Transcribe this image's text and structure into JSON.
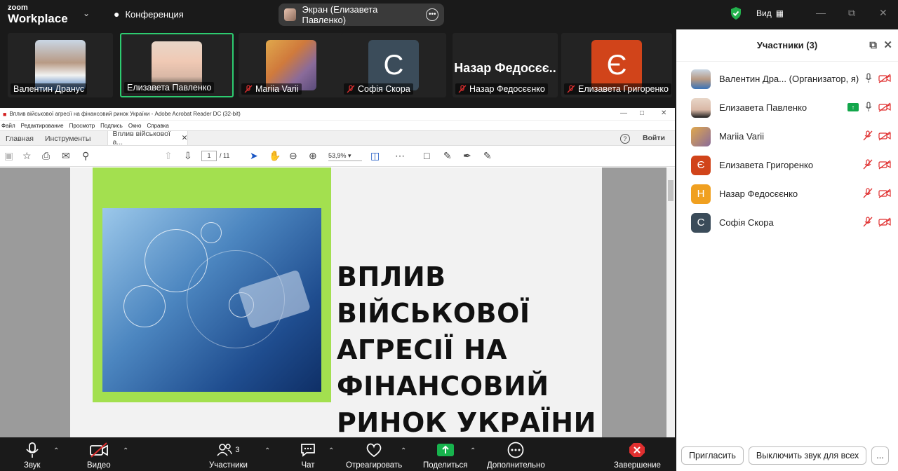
{
  "app": {
    "logo_line1": "zoom",
    "logo_line2": "Workplace",
    "conference_label": "Конференция",
    "share_pill_label": "Экран (Елизавета Павленко)",
    "view_label": "Вид"
  },
  "gallery": [
    {
      "name": "Валентин Дранус",
      "muted": false,
      "avatar": "photo"
    },
    {
      "name": "Елизавета Павленко",
      "muted": false,
      "avatar": "photo",
      "active": true
    },
    {
      "name": "Mariia Varii",
      "muted": true,
      "avatar": "cartoon"
    },
    {
      "name": "Софія Скора",
      "muted": true,
      "avatar": "letter",
      "letter": "С",
      "color": "#3b4c5a"
    },
    {
      "name": "Назар Федосєєнко",
      "muted": true,
      "avatar": "bigname",
      "bigname": "Назар  Федосєє.."
    },
    {
      "name": "Елизавета Григоренко",
      "muted": true,
      "avatar": "letter",
      "letter": "Є",
      "color": "#d1441a"
    }
  ],
  "acrobat": {
    "window_title": "Вплив військової агресії на фінансовий ринок України - Adobe Acrobat Reader DC (32-bit)",
    "menu": [
      "Файл",
      "Редактирование",
      "Просмотр",
      "Подпись",
      "Окно",
      "Справка"
    ],
    "tabs": {
      "home": "Главная",
      "tools": "Инструменты",
      "doc": "Вплив військової а..."
    },
    "login": "Войти",
    "help": "?",
    "page_current": "1",
    "page_total": "/ 11",
    "zoom": "53,9%",
    "slide_heading": [
      "ВПЛИВ",
      "ВІЙСЬКОВОЇ",
      "АГРЕСІЇ НА",
      "ФІНАНСОВИЙ",
      "РИНОК УКРАЇНИ"
    ]
  },
  "panel": {
    "title": "Участники (3)",
    "participants": [
      {
        "name": "Валентин Дра...",
        "suffix": "(Организатор, я)",
        "avatar": "photo",
        "mic": "on",
        "video": "off",
        "sharing": false
      },
      {
        "name": "Елизавета Павленко",
        "suffix": "",
        "avatar": "photo",
        "mic": "on",
        "video": "off",
        "sharing": true
      },
      {
        "name": "Mariia Varii",
        "suffix": "",
        "avatar": "cartoon",
        "mic": "off",
        "video": "off",
        "sharing": false
      },
      {
        "name": "Елизавета Григоренко",
        "suffix": "",
        "avatar": "letter",
        "letter": "Є",
        "color": "#d1441a",
        "mic": "off",
        "video": "off",
        "sharing": false
      },
      {
        "name": "Назар Федосєєнко",
        "suffix": "",
        "avatar": "letter",
        "letter": "Н",
        "color": "#f0a020",
        "mic": "off",
        "video": "off",
        "sharing": false
      },
      {
        "name": "Софія Скора",
        "suffix": "",
        "avatar": "letter",
        "letter": "С",
        "color": "#3b4c5a",
        "mic": "off",
        "video": "off",
        "sharing": false
      }
    ],
    "invite_label": "Пригласить",
    "mute_all_label": "Выключить звук для всех",
    "more_label": "..."
  },
  "controls": {
    "audio": "Звук",
    "video": "Видео",
    "participants": "Участники",
    "participants_count": "3",
    "chat": "Чат",
    "react": "Отреагировать",
    "share": "Поделиться",
    "more": "Дополнительно",
    "end": "Завершение"
  }
}
